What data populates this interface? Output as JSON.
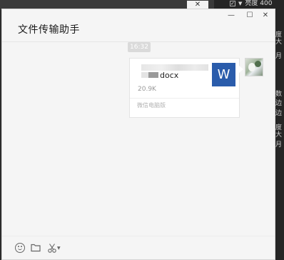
{
  "window": {
    "title": "文件传输助手"
  },
  "window_controls": {
    "minimize": "—",
    "maximize": "☐",
    "close": "✕"
  },
  "chat": {
    "timestamp": "16:32",
    "message": {
      "file_name_visible": "docx",
      "file_size": "20.9K",
      "file_type_icon": "W",
      "source": "微信电脑版"
    }
  },
  "background": {
    "close_glyph": "✕",
    "top_right_text": "亮度 400",
    "side_chars": [
      "度大",
      "月",
      "数",
      "边",
      "边",
      "度大",
      "月"
    ]
  },
  "colors": {
    "word_blue": "#2a5cab",
    "time_pill": "#dadada",
    "window_bg": "#f5f5f5"
  },
  "toolbar": {
    "icons": [
      "smile-icon",
      "folder-icon",
      "scissors-icon",
      "chevron-down-icon"
    ]
  }
}
